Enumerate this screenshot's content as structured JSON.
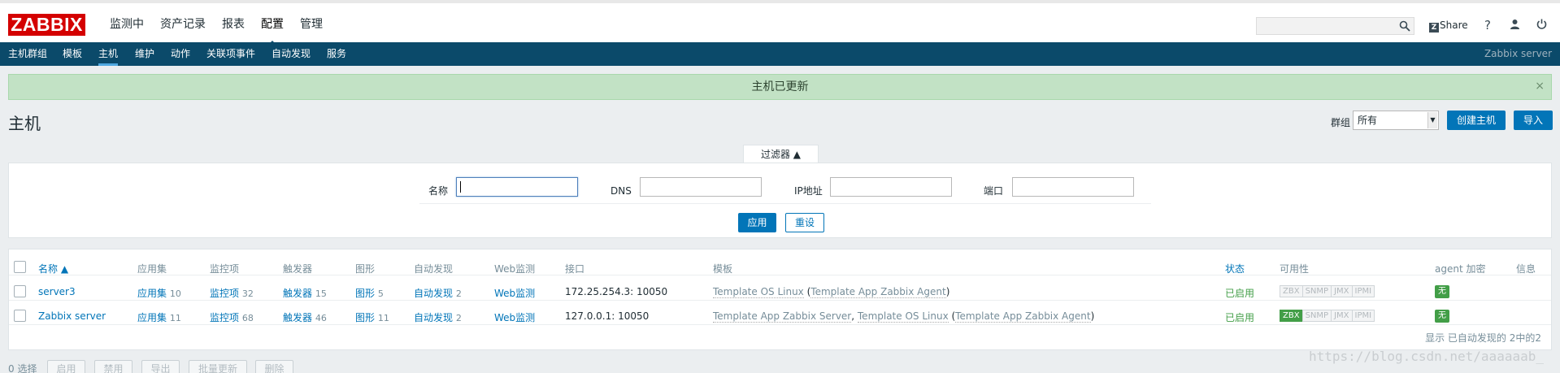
{
  "app": {
    "logo": "ZABBIX"
  },
  "top_menu": [
    "监测中",
    "资产记录",
    "报表",
    "配置",
    "管理"
  ],
  "top_menu_active": "配置",
  "header_right": {
    "share_icon_text": "Z",
    "share_label": "Share",
    "help_glyph": "?",
    "user_glyph": "👤",
    "power_glyph": "⏻",
    "search_placeholder": ""
  },
  "sub_menu": [
    "主机群组",
    "模板",
    "主机",
    "维护",
    "动作",
    "关联项事件",
    "自动发现",
    "服务"
  ],
  "sub_menu_active": "主机",
  "server_label": "Zabbix server",
  "message": {
    "text": "主机已更新",
    "close": "×"
  },
  "page": {
    "title": "主机",
    "group_label": "群组",
    "group_value": "所有",
    "create_button": "创建主机",
    "import_button": "导入"
  },
  "filter": {
    "tab_label": "过滤器 ▲",
    "name_label": "名称",
    "dns_label": "DNS",
    "ip_label": "IP地址",
    "port_label": "端口",
    "name_value": "",
    "dns_value": "",
    "ip_value": "",
    "port_value": "",
    "apply_button": "应用",
    "reset_button": "重设"
  },
  "table": {
    "headers": {
      "name": "名称 ▲",
      "apps": "应用集",
      "items": "监控项",
      "triggers": "触发器",
      "graphs": "图形",
      "discovery": "自动发现",
      "web": "Web监测",
      "interface": "接口",
      "templates": "模板",
      "status": "状态",
      "availability": "可用性",
      "encryption": "agent 加密",
      "info": "信息"
    },
    "rows": [
      {
        "name": "server3",
        "apps_label": "应用集",
        "apps_count": "10",
        "items_label": "监控项",
        "items_count": "32",
        "triggers_label": "触发器",
        "triggers_count": "15",
        "graphs_label": "图形",
        "graphs_count": "5",
        "discovery_label": "自动发现",
        "discovery_count": "2",
        "web_label": "Web监测",
        "interface": "172.25.254.3: 10050",
        "template_1": "Template OS Linux",
        "template_sep_open": " (",
        "template_2": "Template App Zabbix Agent",
        "template_sep_close": ")",
        "status": "已启用",
        "av": [
          "ZBX",
          "SNMP",
          "JMX",
          "IPMI"
        ],
        "av_zbx_on": false,
        "encryption": "无"
      },
      {
        "name": "Zabbix server",
        "apps_label": "应用集",
        "apps_count": "11",
        "items_label": "监控项",
        "items_count": "68",
        "triggers_label": "触发器",
        "triggers_count": "46",
        "graphs_label": "图形",
        "graphs_count": "11",
        "discovery_label": "自动发现",
        "discovery_count": "2",
        "web_label": "Web监测",
        "interface": "127.0.0.1: 10050",
        "template_1": "Template App Zabbix Server",
        "template_sep_mid": ", ",
        "template_2": "Template OS Linux",
        "template_sep_open": " (",
        "template_3": "Template App Zabbix Agent",
        "template_sep_close": ")",
        "status": "已启用",
        "av": [
          "ZBX",
          "SNMP",
          "JMX",
          "IPMI"
        ],
        "av_zbx_on": true,
        "encryption": "无"
      }
    ],
    "footer": "显示 已自动发现的 2中的2"
  },
  "bottom_bar": {
    "selected": "0 选择",
    "buttons": [
      "启用",
      "禁用",
      "导出",
      "批量更新",
      "删除"
    ]
  },
  "watermark": "https://blog.csdn.net/aaaaaab_"
}
